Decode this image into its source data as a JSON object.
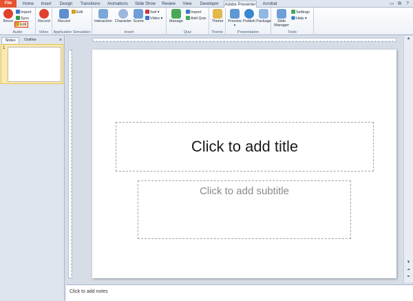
{
  "tabs": {
    "file": "File",
    "home": "Home",
    "insert": "Insert",
    "design": "Design",
    "transitions": "Transitions",
    "animations": "Animations",
    "slideshow": "Slide Show",
    "review": "Review",
    "view": "View",
    "developer": "Developer",
    "presenter": "Adobe Presenter",
    "acrobat": "Acrobat"
  },
  "ribbon": {
    "audio": {
      "record": "Recor",
      "import": "Import",
      "sync": "Sync",
      "edit": "Edit",
      "label": "Audio"
    },
    "video": {
      "record": "Record",
      "label": "Video"
    },
    "appsim": {
      "record": "Record",
      "edit": "Edit",
      "label": "Application Simulation"
    },
    "insert": {
      "interaction": "Interaction",
      "character": "Character",
      "scene": "Scene",
      "swf": "Swf",
      "video": "Video",
      "label": "Insert"
    },
    "quiz": {
      "manage": "Manage",
      "import": "Import",
      "add_quiz": "Add Quiz",
      "label": "Quiz"
    },
    "theme": {
      "theme": "Theme",
      "label": "Theme"
    },
    "presentation": {
      "preview": "Preview",
      "publish": "Publish",
      "package": "Package",
      "label": "Presentation"
    },
    "tools": {
      "slide_manager_1": "Slide",
      "slide_manager_2": "Manager",
      "settings": "Settings",
      "help": "Help",
      "label": "Tools"
    }
  },
  "panel": {
    "slides_tab": "Slides",
    "outline_tab": "Outline",
    "close": "×",
    "slide_number": "1"
  },
  "slide": {
    "title_placeholder": "Click to add title",
    "subtitle_placeholder": "Click to add subtitle"
  },
  "notes": {
    "placeholder": "Click to add notes"
  },
  "colors": {
    "file_tab": "#e5532f",
    "record_red": "#e0412c",
    "highlight": "#d8241f"
  }
}
